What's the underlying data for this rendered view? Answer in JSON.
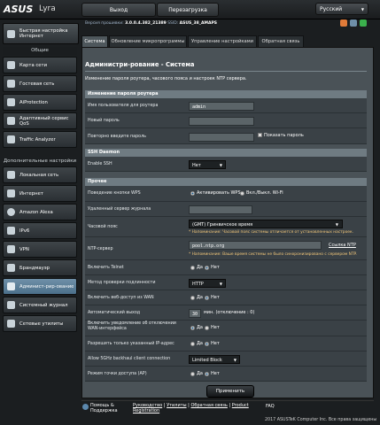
{
  "header": {
    "logo": "ASUS",
    "model": "Lyra",
    "logout_label": "Выход",
    "reboot_label": "Перезагрузка",
    "language_label": "Русский",
    "dropdown_arrow": "▼"
  },
  "info": {
    "firmware_label": "Версия прошивки:",
    "firmware_value": "3.0.0.4.382_21389",
    "ssid_label": "SSID:",
    "ssid_value": "ASUS_38_AMAPS"
  },
  "sidebar": {
    "qis_label": "Быстрая настройка Интернет",
    "general_header": "Общие",
    "general_items": [
      "Карта сети",
      "Гостевая сеть",
      "AiProtection",
      "Адаптивный сервис QoS",
      "Traffic Analyzer"
    ],
    "advanced_header": "Дополнительные настройки",
    "advanced_items": [
      "Локальная сеть",
      "Интернет",
      "Amazon Alexa",
      "IPv6",
      "VPN",
      "Брандмауэр",
      "Админист-рир-ование",
      "Системный журнал",
      "Сетевые утилиты"
    ]
  },
  "tabs": [
    "Система",
    "Обновление микропрограммы",
    "Управление настройками",
    "Обратная связь"
  ],
  "page": {
    "title": "Администри-рование - Система",
    "description": "Изменение пароля роутера, часового пояса и настроек NTP сервера."
  },
  "section_password": {
    "header": "Изменение пароля роутера",
    "username_label": "Имя пользователя для роутера",
    "username_value": "admin",
    "new_password_label": "Новый пароль",
    "repeat_password_label": "Повторно введите пароль",
    "show_password_label": "Показать пароль"
  },
  "section_ssh": {
    "header": "SSH Daemon",
    "enable_label": "Enable SSH",
    "enable_value": "Нет"
  },
  "section_misc": {
    "header": "Прочее",
    "wps_label": "Поведение кнопки WPS",
    "wps_opt1": "Активировать WPS",
    "wps_opt2": "Вкл./Выкл. Wi-Fi",
    "remote_log_label": "Удаленный сервер журнала",
    "timezone_label": "Часовой пояс",
    "timezone_value": "(GMT) Гринвичское время",
    "timezone_note": "* Напоминание: Часовой пояс системы отличается от установленных настроек.",
    "ntp_label": "NTP-сервер",
    "ntp_value": "pool.ntp.org",
    "ntp_link": "Ссылка NTP",
    "ntp_note": "* Напоминание: Ваше время системы не было синхронизировано с сервером NTP.",
    "telnet_label": "Включить Telnet",
    "auth_label": "Метод проверки подлинности",
    "auth_value": "HTTP",
    "wan_web_label": "Включить веб-доступ из WAN",
    "autologout_label": "Автоматический выход",
    "autologout_value": "30",
    "autologout_unit": "мин. (отключение : 0)",
    "wan_notify_label": "Включить уведомление об отключении WAN-интерфейса",
    "ip_only_label": "Разрешить только указанный IP-адрес",
    "backhaul_label": "Allow 5GHz backhaul client connection",
    "backhaul_value": "Limited Block",
    "ap_mode_label": "Режим точки доступа (AP)",
    "yes": "Да",
    "no": "Нет"
  },
  "apply_label": "Применить",
  "footer": {
    "help_label": "Помощь & Поддержка",
    "links": [
      "Руководство",
      "Утилиты",
      "Обратная связь",
      "Product Registration"
    ],
    "faq": "FAQ",
    "copyright": "2017 ASUSTeK Computer Inc. Все права защищены"
  },
  "colors": {
    "accent": "#4b6f8a",
    "note": "#f4c87a"
  }
}
